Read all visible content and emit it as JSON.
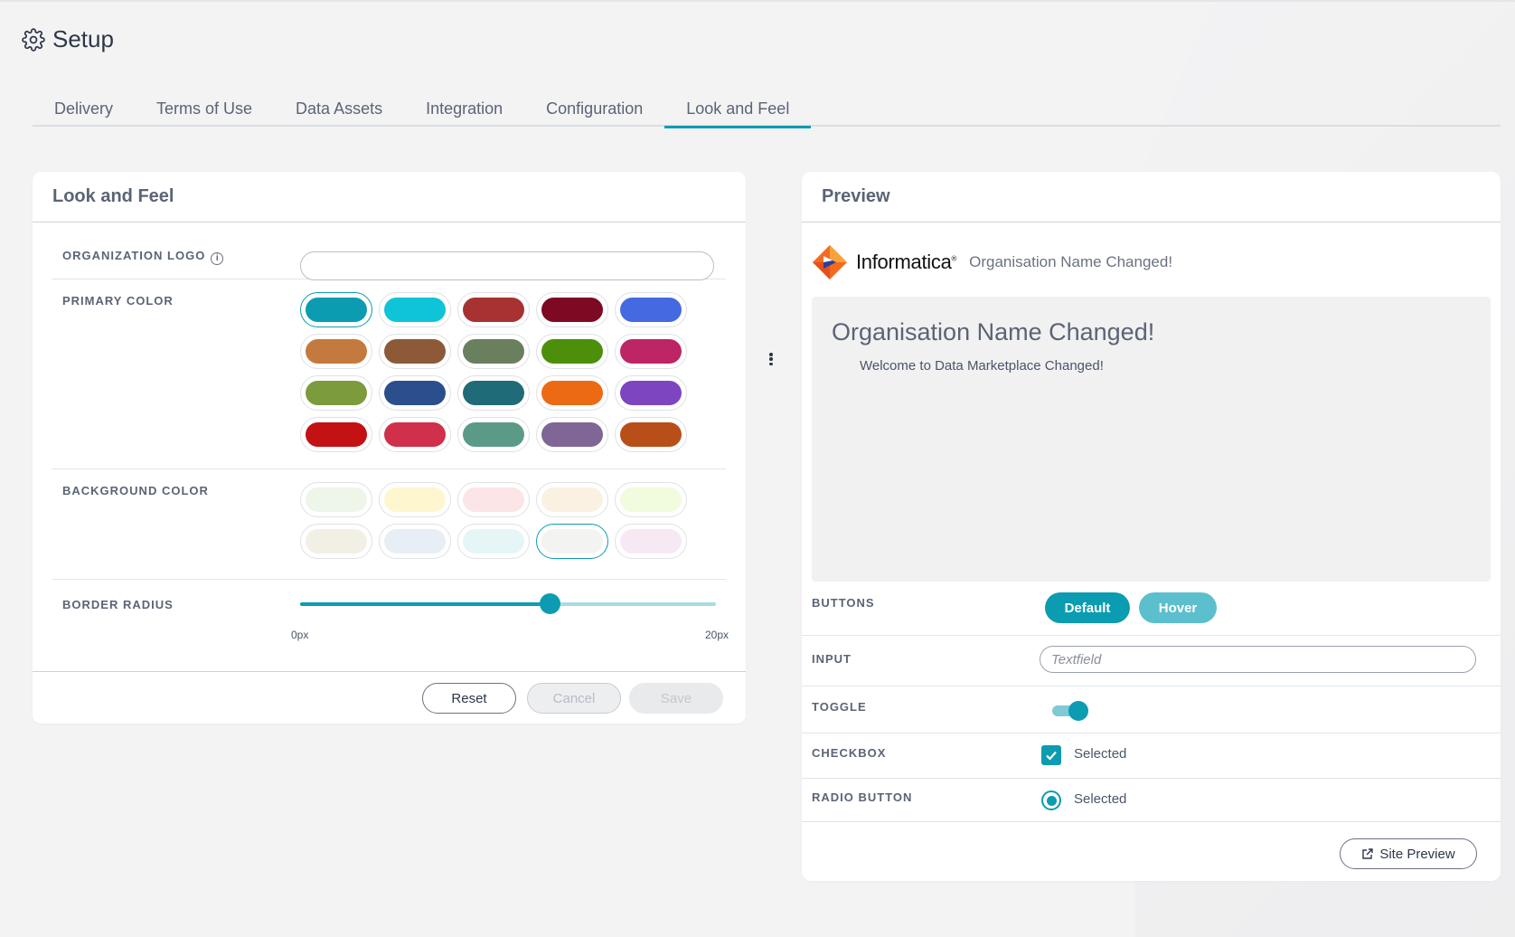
{
  "page": {
    "title": "Setup",
    "icon": "gear-icon"
  },
  "tabs": [
    {
      "label": "Delivery"
    },
    {
      "label": "Terms of Use"
    },
    {
      "label": "Data Assets"
    },
    {
      "label": "Integration"
    },
    {
      "label": "Configuration"
    },
    {
      "label": "Look and Feel",
      "active": true
    }
  ],
  "look_and_feel": {
    "title": "Look and Feel",
    "org_logo_label": "ORGANIZATION LOGO",
    "org_logo_value": "",
    "primary_color_label": "PRIMARY COLOR",
    "primary_colors": [
      "#0c9cb1",
      "#0ec4d6",
      "#a83232",
      "#7d0a22",
      "#4469e0",
      "#c47a3e",
      "#8d5a38",
      "#6a7f5e",
      "#4b8f0b",
      "#bd2565",
      "#7c9b3c",
      "#2a4f8c",
      "#1f6b77",
      "#ec6a14",
      "#7e45c0",
      "#c41114",
      "#d03049",
      "#5c9a88",
      "#7f6696",
      "#b84f19"
    ],
    "primary_selected_index": 0,
    "background_color_label": "BACKGROUND COLOR",
    "background_colors": [
      "#eef5e9",
      "#fdf6cf",
      "#fbe5e7",
      "#fbf1e3",
      "#f1fbde",
      "#f2efe4",
      "#e8eef6",
      "#e6f5f6",
      "#f3f3f2",
      "#f7e9f3"
    ],
    "background_selected_index": 8,
    "border_radius_label": "BORDER RADIUS",
    "border_radius_value": 12,
    "border_radius_max": 20,
    "border_radius_min_label": "0px",
    "border_radius_max_label": "20px",
    "reset_label": "Reset",
    "cancel_label": "Cancel",
    "save_label": "Save"
  },
  "preview": {
    "title": "Preview",
    "brand_name": "Informatica",
    "brand_mark": "®",
    "org_name": "Organisation Name Changed!",
    "hero_title": "Organisation Name Changed!",
    "hero_subtitle": "Welcome to Data Marketplace Changed!",
    "buttons_label": "BUTTONS",
    "default_button": "Default",
    "hover_button": "Hover",
    "input_label": "INPUT",
    "input_placeholder": "Textfield",
    "toggle_label": "TOGGLE",
    "checkbox_label": "CHECKBOX",
    "checkbox_text": "Selected",
    "radio_label": "RADIO BUTTON",
    "radio_text": "Selected",
    "site_preview_label": "Site Preview"
  }
}
